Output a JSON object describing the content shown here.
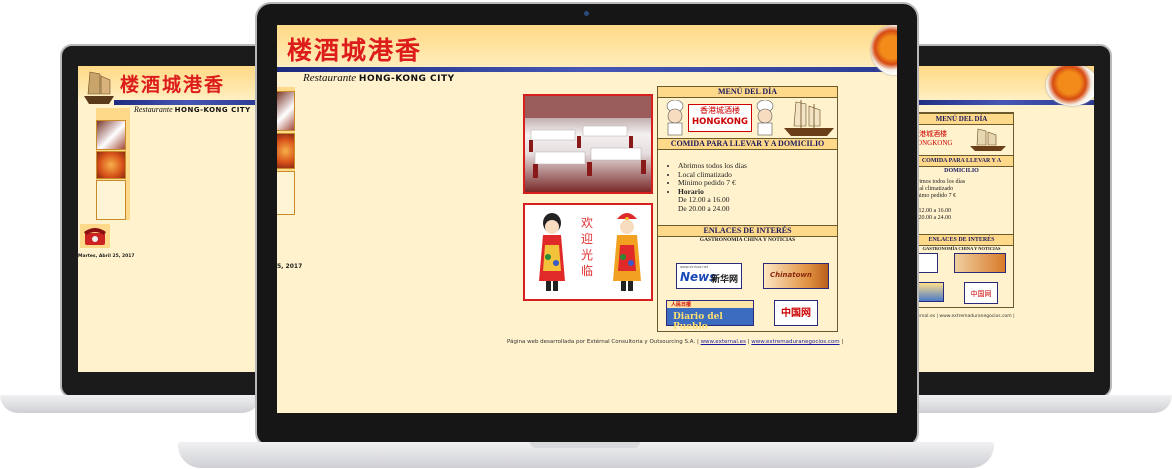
{
  "site": {
    "chinese_title": "楼酒城港香",
    "subtitle_prefix": "Restaurante",
    "subtitle_name": "HONG-KONG CITY",
    "date": "Martes, Abril 25, 2017",
    "date_partial": "5, 2017"
  },
  "menu": {
    "menu_heading": "MENÚ DEL DÍA",
    "banner_cn": "香港城酒楼",
    "banner_en": "HONGKONG",
    "delivery_heading": "COMIDA PARA LLEVAR Y A DOMICILIO",
    "items": [
      "Abrimos todos los días",
      "Local climatizado",
      "Mínimo pedido 7 €"
    ],
    "hours_label": "Horario",
    "hours": [
      "De 12.00 a 16.00",
      "De 20.00 a 24.00"
    ],
    "links_heading": "ENLACES DE INTERÉS",
    "links_subheading": "GASTRONOMÍA CHINA Y NOTICIAS"
  },
  "welcome_text": "欢迎光临",
  "logos": {
    "xinhua_small": "www.xinhua.net",
    "xinhua_news": "News",
    "xinhua_cn": "新华网",
    "chinatown": "Chinatown",
    "diario": "Diario del Pueblo",
    "diario_top": "人民日报",
    "zhongguo": "中国网"
  },
  "footer": {
    "text": "Página web desarrollada por Extérnal Consultoria y Outsourcing S.A. |",
    "link1": "www.external.es",
    "sep": "|",
    "link2": "www.extremaduranegocios.com",
    "end": "|",
    "partial": "external.es | www.extremaduranegocios.com |"
  },
  "colors": {
    "header": "#ffd986",
    "page_bg": "#fff2cc",
    "title_red": "#dd1c1c",
    "bar_blue": "#2a3a94",
    "box_head": "#ffd98a"
  }
}
